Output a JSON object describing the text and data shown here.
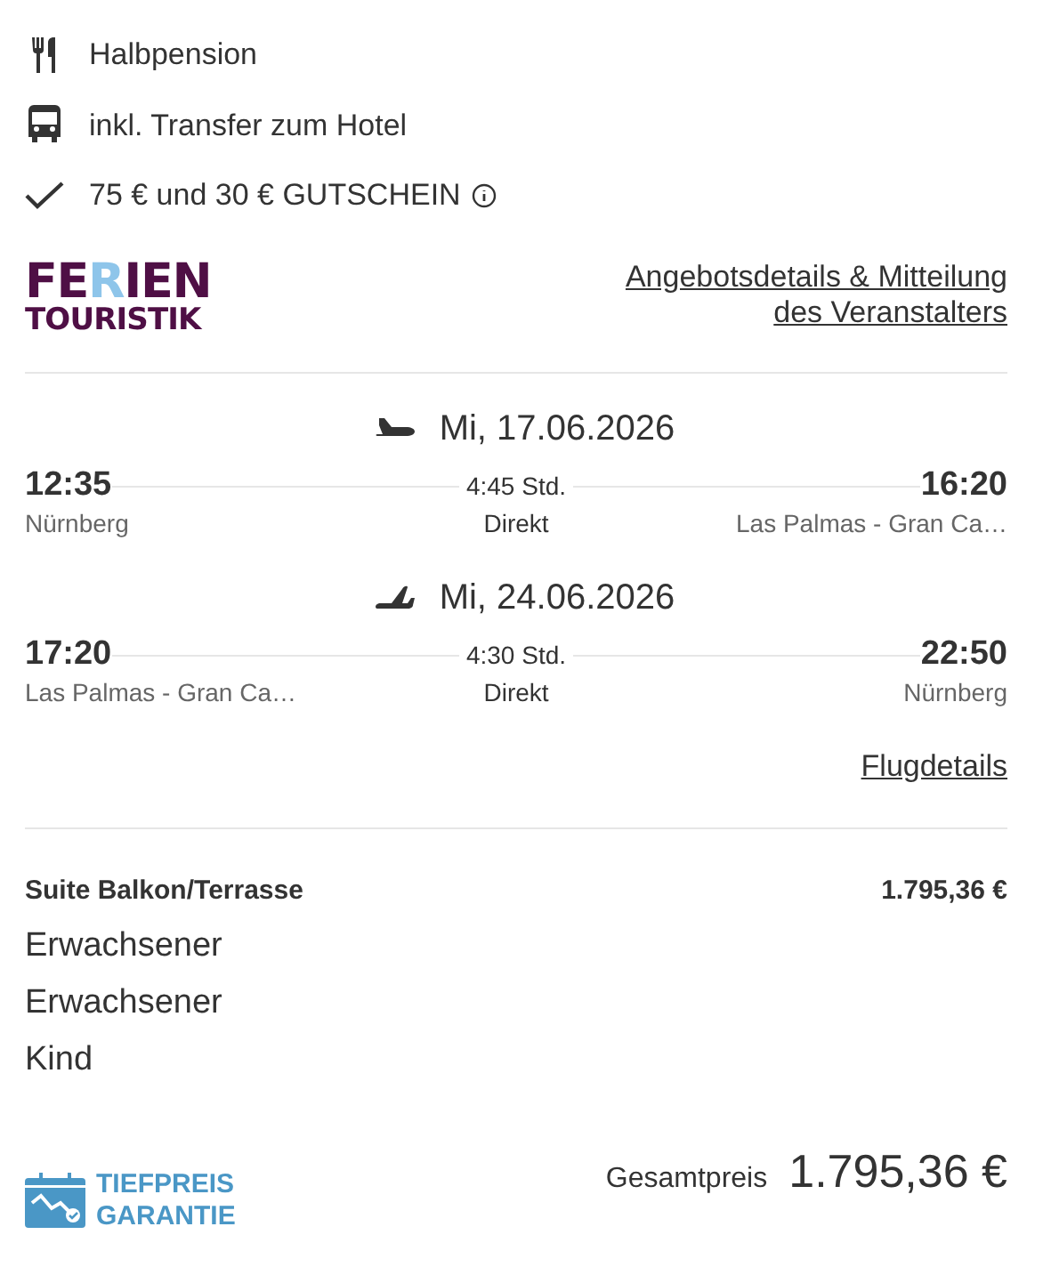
{
  "features": [
    {
      "kind": "meal",
      "text": "Halbpension",
      "info": false
    },
    {
      "kind": "bus",
      "text": "inkl. Transfer zum Hotel",
      "info": false
    },
    {
      "kind": "check",
      "text": "75 € und 30 € GUTSCHEIN",
      "info": true
    }
  ],
  "logo": {
    "line1": [
      {
        "text": "FE",
        "color": "#4f0f45"
      },
      {
        "text": "R",
        "color": "#8ec5ea"
      },
      {
        "text": "IEN",
        "color": "#4f0f45"
      }
    ],
    "line2": "TOURISTIK"
  },
  "offer_link": [
    "Angebotsdetails & Mitteilung",
    "des Veranstalters"
  ],
  "flights": [
    {
      "kind": "outbound",
      "date": "Mi, 17.06.2026",
      "departure_time": "12:35",
      "departure_place": "Nürnberg",
      "duration": "4:45 Std.",
      "stops": "Direkt",
      "arrival_time": "16:20",
      "arrival_place": "Las Palmas - Gran Ca…"
    },
    {
      "kind": "return",
      "date": "Mi, 24.06.2026",
      "departure_time": "17:20",
      "departure_place": "Las Palmas - Gran Ca…",
      "duration": "4:30 Std.",
      "stops": "Direkt",
      "arrival_time": "22:50",
      "arrival_place": "Nürnberg"
    }
  ],
  "flight_details_link": "Flugdetails",
  "room": {
    "name": "Suite Balkon/Terrasse",
    "price": "1.795,36 €",
    "travellers": [
      "Erwachsener",
      "Erwachsener",
      "Kind"
    ]
  },
  "badge": [
    "TIEFPREIS",
    "GARANTIE"
  ],
  "total": {
    "label": "Gesamtpreis",
    "price": "1.795,36 €"
  }
}
